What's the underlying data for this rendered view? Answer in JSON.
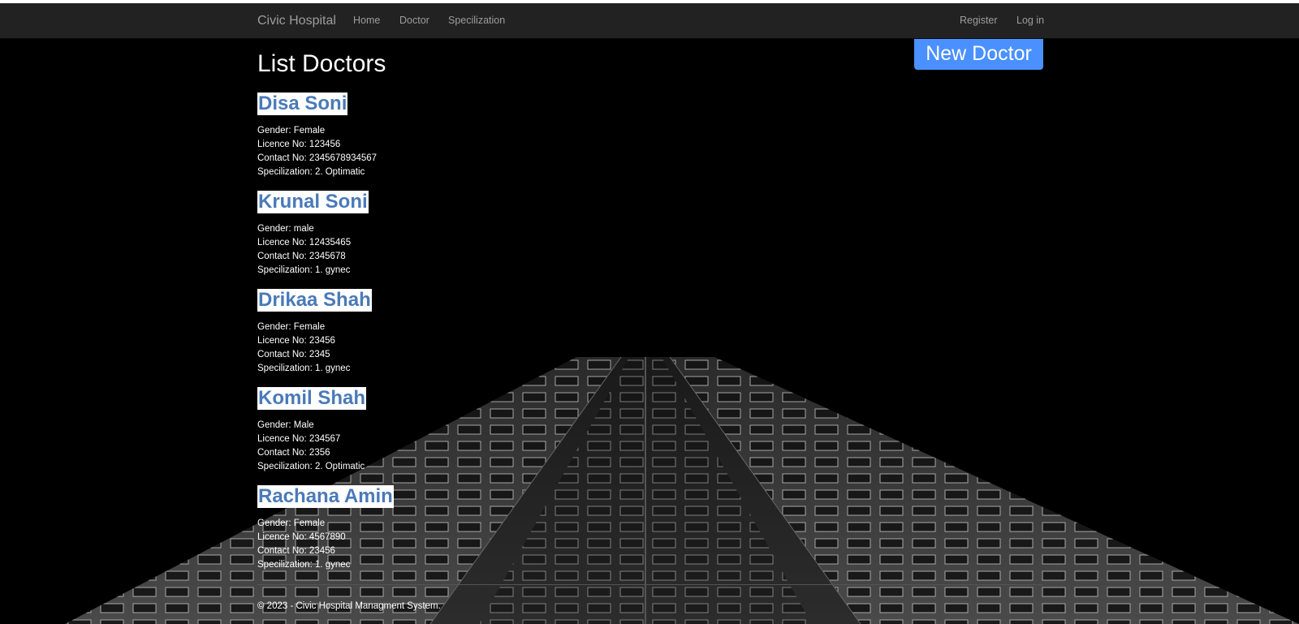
{
  "navbar": {
    "brand": "Civic Hospital",
    "links": [
      "Home",
      "Doctor",
      "Specilization"
    ],
    "right_links": [
      "Register",
      "Log in"
    ]
  },
  "page": {
    "title": "List Doctors",
    "new_button": "New Doctor"
  },
  "doctors": [
    {
      "name": "Disa Soni",
      "gender": "Gender: Female",
      "licence": "Licence No: 123456",
      "contact": "Contact No: 2345678934567",
      "specilization": "Specilization: 2. Optimatic"
    },
    {
      "name": "Krunal Soni",
      "gender": "Gender: male",
      "licence": "Licence No: 12435465",
      "contact": "Contact No: 2345678",
      "specilization": "Specilization: 1. gynec"
    },
    {
      "name": "Drikaa Shah",
      "gender": "Gender: Female",
      "licence": "Licence No: 23456",
      "contact": "Contact No: 2345",
      "specilization": "Specilization: 1. gynec"
    },
    {
      "name": "Komil Shah",
      "gender": "Gender: Male",
      "licence": "Licence No: 234567",
      "contact": "Contact No: 2356",
      "specilization": "Specilization: 2. Optimatic"
    },
    {
      "name": "Rachana Amin",
      "gender": "Gender: Female",
      "licence": "Licence No: 4567890",
      "contact": "Contact No: 23456",
      "specilization": "Specilization: 1. gynec"
    }
  ],
  "footer": {
    "text": "© 2023 - Civic Hospital Managment System."
  },
  "colors": {
    "navbar_bg": "#222222",
    "nav_link": "#9d9d9d",
    "button_bg": "#4a90ff",
    "name_text": "#4a7ab8",
    "name_bg": "#ffffff"
  }
}
